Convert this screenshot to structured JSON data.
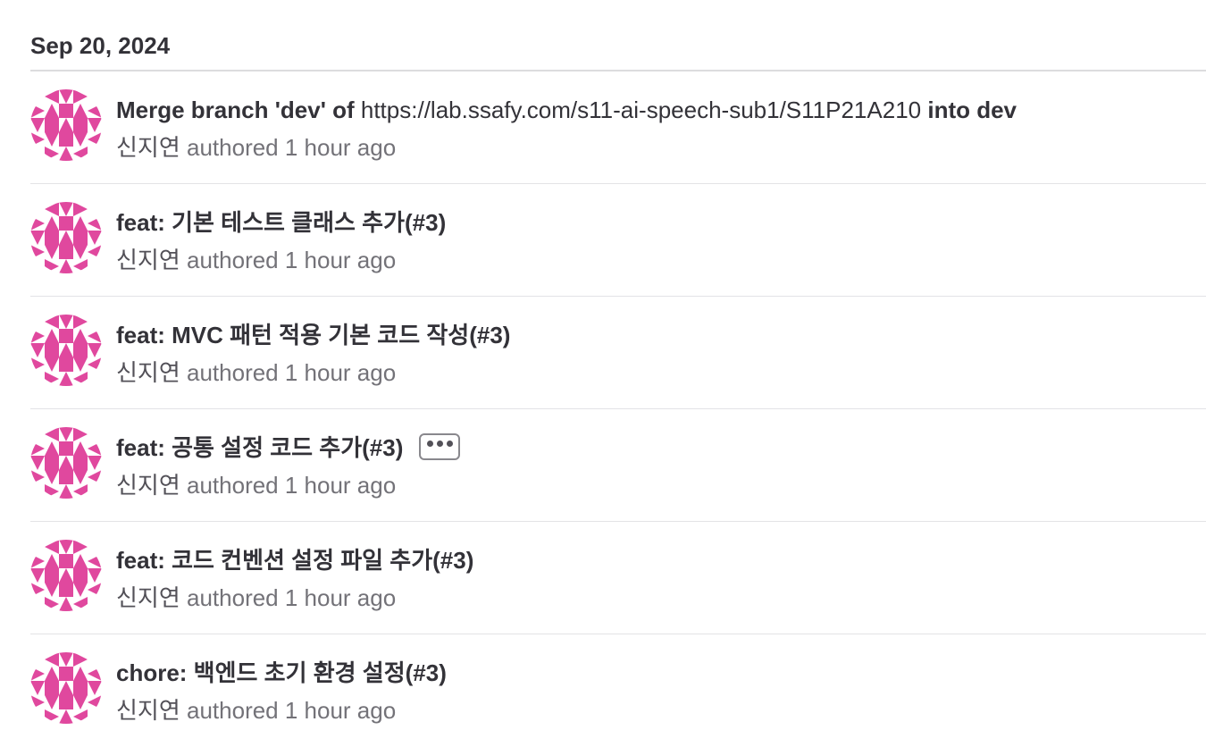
{
  "day_header": {
    "date": "Sep 20, 2024"
  },
  "colors": {
    "avatar_pink": "#e0489e",
    "text": "#333238",
    "muted": "#737278",
    "border": "#dcdcde"
  },
  "commits": [
    {
      "title_prefix": "Merge branch 'dev' of ",
      "title_link": "https://lab.ssafy.com/s11-ai-speech-sub1/S11P21A210",
      "title_suffix": " into dev",
      "author": "신지연",
      "authored": "authored 1 hour ago",
      "avatar_icon": "identicon-avatar"
    },
    {
      "title": "feat: 기본 테스트 클래스 추가(#3)",
      "author": "신지연",
      "authored": "authored 1 hour ago",
      "avatar_icon": "identicon-avatar"
    },
    {
      "title": "feat: MVC 패턴 적용 기본 코드 작성(#3)",
      "author": "신지연",
      "authored": "authored 1 hour ago",
      "avatar_icon": "identicon-avatar"
    },
    {
      "title": "feat: 공통 설정 코드 추가(#3)",
      "author": "신지연",
      "authored": "authored 1 hour ago",
      "avatar_icon": "identicon-avatar",
      "has_description_toggle": true,
      "toggle_icon": "ellipsis-icon"
    },
    {
      "title": "feat: 코드 컨벤션 설정 파일 추가(#3)",
      "author": "신지연",
      "authored": "authored 1 hour ago",
      "avatar_icon": "identicon-avatar"
    },
    {
      "title": "chore: 백엔드 초기 환경 설정(#3)",
      "author": "신지연",
      "authored": "authored 1 hour ago",
      "avatar_icon": "identicon-avatar"
    }
  ]
}
